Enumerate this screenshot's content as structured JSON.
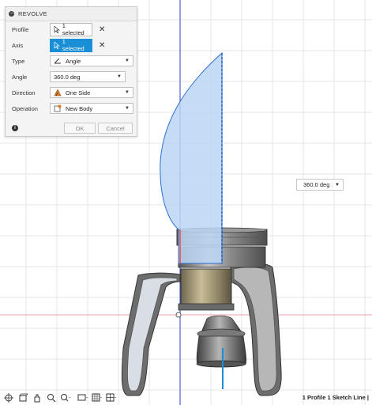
{
  "revolve_panel": {
    "title": "REVOLVE",
    "profile": {
      "label": "Profile",
      "value": "1 selected"
    },
    "axis": {
      "label": "Axis",
      "value": "1 selected"
    },
    "type": {
      "label": "Type",
      "value": "Angle"
    },
    "angle": {
      "label": "Angle",
      "value": "360.0 deg"
    },
    "direction": {
      "label": "Direction",
      "value": "One Side"
    },
    "operation": {
      "label": "Operation",
      "value": "New Body"
    },
    "ok_label": "OK",
    "cancel_label": "Cancel"
  },
  "canvas_angle": {
    "value": "360.0 deg"
  },
  "status": {
    "text": "1 Profile 1 Sketch Line |"
  },
  "bottom_toolbar": {
    "icons": [
      "orbit-icon",
      "view-cube-icon",
      "pan-icon",
      "zoom-icon",
      "zoom-window-icon",
      "display-icon",
      "grid-icon",
      "layout-icon"
    ]
  },
  "colors": {
    "accent": "#1a8fd6",
    "profile_fill": "#bcd6f4",
    "body": "#8c8c8c"
  }
}
